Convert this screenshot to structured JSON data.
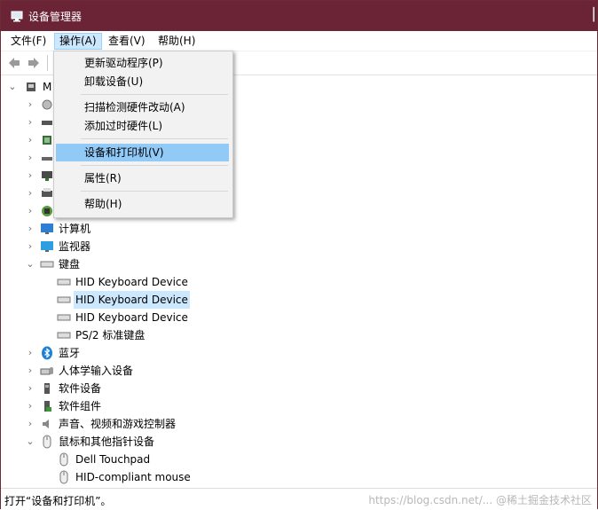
{
  "window": {
    "title": "设备管理器"
  },
  "menubar": {
    "items": [
      "文件(F)",
      "操作(A)",
      "查看(V)",
      "帮助(H)"
    ]
  },
  "context_menu": {
    "items": [
      "更新驱动程序(P)",
      "卸载设备(U)",
      "扫描检测硬件改动(A)",
      "添加过时硬件(L)",
      "设备和打印机(V)",
      "属性(R)",
      "帮助(H)"
    ],
    "highlighted": "设备和打印机(V)"
  },
  "tree": {
    "root_label": "M",
    "categories": {
      "computer": "计算机",
      "monitor": "监视器",
      "keyboard": "键盘",
      "bluetooth": "蓝牙",
      "hid": "人体学输入设备",
      "software_devices": "软件设备",
      "software_components": "软件组件",
      "audio": "声音、视频和游戏控制器",
      "mouse": "鼠标和其他指针设备"
    },
    "keyboards": [
      "HID Keyboard Device",
      "HID Keyboard Device",
      "HID Keyboard Device",
      "PS/2 标准键盘"
    ],
    "mice": [
      "Dell Touchpad",
      "HID-compliant mouse"
    ]
  },
  "status": {
    "text": "打开“设备和打印机”。",
    "watermark": "https://blog.csdn.net/... @稀土掘金技术社区"
  },
  "colors": {
    "titlebar": "#6b2436",
    "selection": "#cce8ff",
    "menu_highlight": "#91c9f7"
  }
}
